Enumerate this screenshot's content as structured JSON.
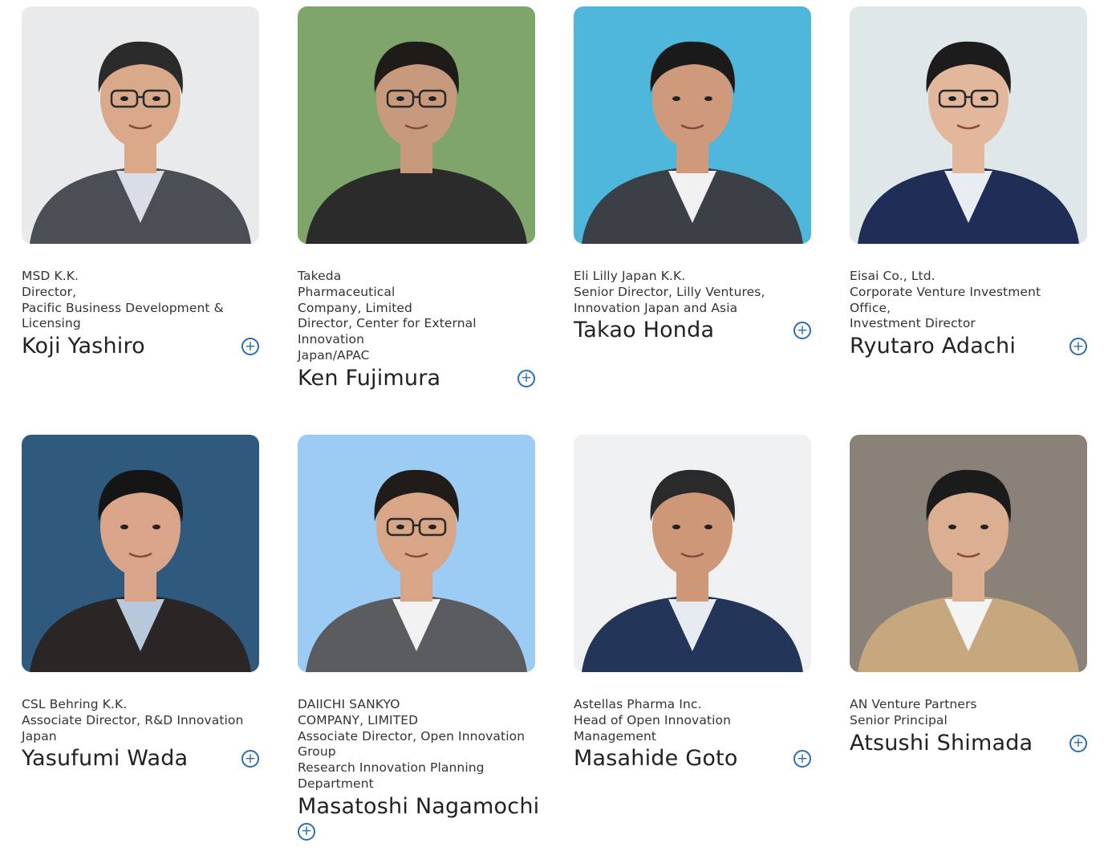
{
  "people": [
    {
      "lines": [
        "MSD K.K.",
        "Director,",
        "Pacific Business Development &",
        "Licensing"
      ],
      "name": "Koji Yashiro",
      "photo": {
        "bg": "#e9eaec",
        "suit": "#4a4e55",
        "shirt": "#d9dde6",
        "skin": "#d9a98a",
        "hair": "#2a2a2a",
        "glasses": true
      }
    },
    {
      "lines": [
        "Takeda",
        "Pharmaceutical",
        "Company, Limited",
        "Director, Center for External",
        "Innovation",
        "Japan/APAC"
      ],
      "name": "Ken Fujimura",
      "photo": {
        "bg": "#7fa56a",
        "suit": "#2b2b2b",
        "shirt": "#2b2b2b",
        "skin": "#c89a7d",
        "hair": "#1e1b18",
        "glasses": true
      }
    },
    {
      "lines": [
        "Eli Lilly Japan K.K.",
        "Senior Director, Lilly Ventures,",
        "Innovation Japan and Asia"
      ],
      "name": "Takao Honda",
      "photo": {
        "bg": "#4fb6dc",
        "suit": "#3b3f46",
        "shirt": "#f1f1f1",
        "skin": "#cf9a7c",
        "hair": "#1a1a1a",
        "glasses": false
      }
    },
    {
      "lines": [
        "Eisai Co., Ltd.",
        "Corporate Venture Investment",
        "Office,",
        "Investment Director"
      ],
      "name": "Ryutaro Adachi",
      "photo": {
        "bg": "#dfe7e8",
        "suit": "#1f2d57",
        "shirt": "#e8ecf3",
        "skin": "#e2b79c",
        "hair": "#1c1c1c",
        "glasses": true
      }
    },
    {
      "lines": [
        "CSL Behring K.K.",
        "Associate Director, R&D Innovation",
        "Japan"
      ],
      "name": "Yasufumi Wada",
      "photo": {
        "bg": "#2f5a7d",
        "suit": "#2b2626",
        "shirt": "#b8c7d9",
        "skin": "#d9a487",
        "hair": "#151515",
        "glasses": false
      }
    },
    {
      "lines": [
        "DAIICHI SANKYO",
        "COMPANY, LIMITED",
        "Associate Director, Open Innovation",
        "Group",
        "Research Innovation Planning",
        "Department"
      ],
      "name": "Masatoshi Nagamochi",
      "photo": {
        "bg": "#9ccbf4",
        "suit": "#5a5c60",
        "shirt": "#f2f2f2",
        "skin": "#d8a686",
        "hair": "#1f1c1a",
        "glasses": true
      }
    },
    {
      "lines": [
        "Astellas Pharma Inc.",
        "Head of Open Innovation",
        "Management"
      ],
      "name": "Masahide Goto",
      "photo": {
        "bg": "#eef0f2",
        "suit": "#233659",
        "shirt": "#e6ebf2",
        "skin": "#cd9778",
        "hair": "#2a2a2a",
        "glasses": false
      }
    },
    {
      "lines": [
        "AN Venture Partners",
        "Senior Principal"
      ],
      "name": "Atsushi Shimada",
      "photo": {
        "bg": "#8a8278",
        "suit": "#c7a77d",
        "shirt": "#f4f4f4",
        "skin": "#dcae92",
        "hair": "#1b1b1b",
        "glasses": false
      }
    }
  ],
  "expand_icon": "plus-circle-icon",
  "accent_color": "#2a6db5"
}
